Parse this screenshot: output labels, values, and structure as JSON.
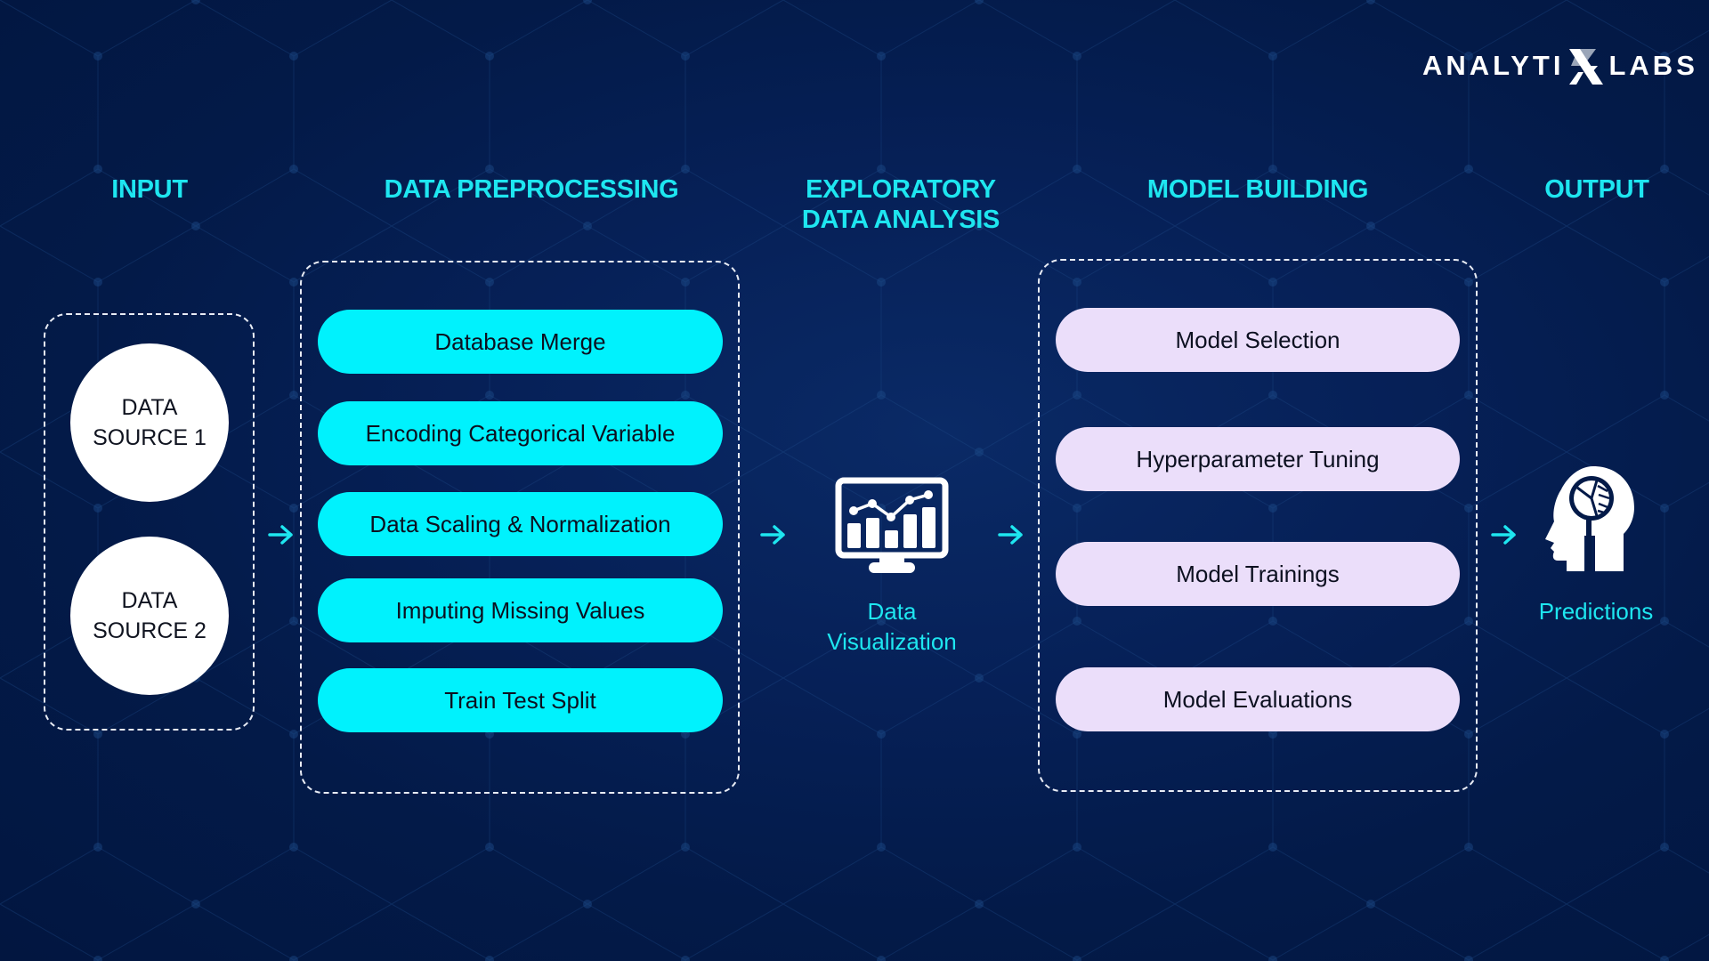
{
  "brand": {
    "text_left": "ANALYTI",
    "text_right": "LABS",
    "mark": "X"
  },
  "colors": {
    "background": "#031a48",
    "heading": "#1ee6f0",
    "preprocessing_pill": "#00f2fd",
    "model_pill": "#ebdefa",
    "circle": "#ffffff",
    "arrow": "#1ee6f0"
  },
  "stages": {
    "input": {
      "heading": "INPUT",
      "sources": [
        "DATA",
        "SOURCE 1",
        "DATA",
        "SOURCE 2"
      ]
    },
    "preprocessing": {
      "heading": "DATA PREPROCESSING",
      "steps": [
        "Database Merge",
        "Encoding Categorical Variable",
        "Data Scaling & Normalization",
        "Imputing Missing Values",
        "Train Test Split"
      ]
    },
    "eda": {
      "heading_line1": "EXPLORATORY",
      "heading_line2": "DATA ANALYSIS",
      "caption_line1": "Data",
      "caption_line2": "Visualization",
      "icon": "monitor-chart-icon"
    },
    "model": {
      "heading": "MODEL BUILDING",
      "steps": [
        "Model Selection",
        "Hyperparameter Tuning",
        "Model Trainings",
        "Model Evaluations"
      ]
    },
    "output": {
      "heading": "OUTPUT",
      "caption": "Predictions",
      "icon": "head-pie-chart-icon"
    }
  },
  "connectors": [
    "arrow-right-icon",
    "arrow-right-icon",
    "arrow-right-icon",
    "arrow-right-icon"
  ]
}
